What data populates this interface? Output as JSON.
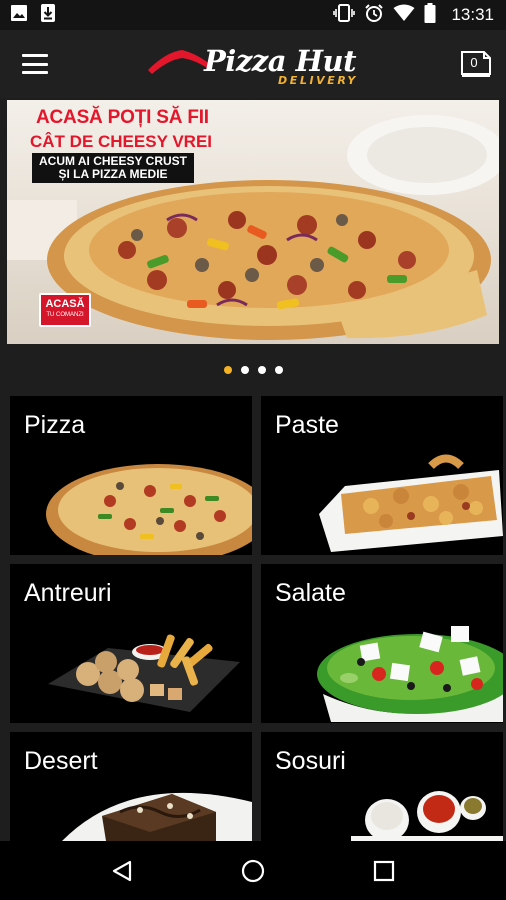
{
  "status_bar": {
    "time": "13:31",
    "icons": [
      "image-icon",
      "download-icon",
      "vibrate-icon",
      "alarm-icon",
      "wifi-icon",
      "battery-icon"
    ]
  },
  "header": {
    "brand_name": "Pizza Hut",
    "brand_tagline": "DELIVERY",
    "cart_count": "0",
    "brand_color": "#e3162b",
    "accent_color": "#f2b233"
  },
  "banner": {
    "line1": "ACASĂ POȚI SĂ FII",
    "line2": "CÂT DE CHEESY VREI",
    "sub_line1": "ACUM AI CHEESY CRUST",
    "sub_line2": "ȘI LA PIZZA MEDIE",
    "badge_main": "ACASĂ",
    "badge_sub": "TU COMANZI",
    "slide_count": 4,
    "active_slide": 1
  },
  "categories": [
    {
      "label": "Pizza"
    },
    {
      "label": "Paste"
    },
    {
      "label": "Antreuri"
    },
    {
      "label": "Salate"
    },
    {
      "label": "Desert"
    },
    {
      "label": "Sosuri"
    }
  ],
  "nav": {
    "back": "back-icon",
    "home": "home-icon",
    "recents": "recents-icon"
  }
}
